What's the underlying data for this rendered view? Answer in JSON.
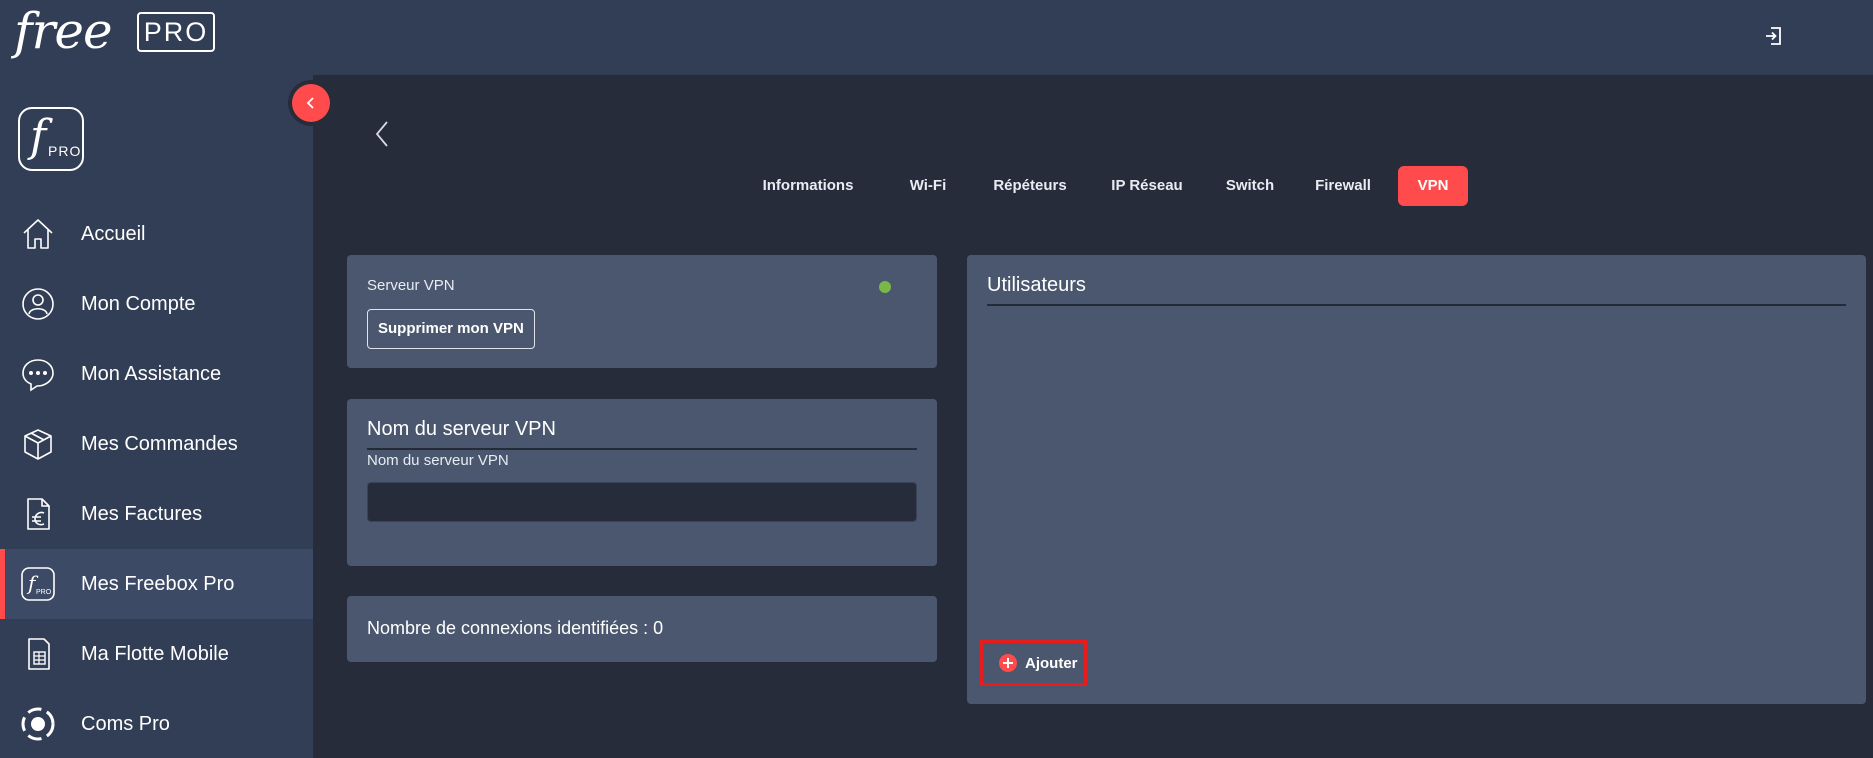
{
  "header": {
    "logo_free": "free",
    "logo_pro": "PRO",
    "logout_icon": "logout-icon"
  },
  "sidebar": {
    "collapse_icon": "chevron-left-icon",
    "logo_letter": "f",
    "logo_sub": "PRO",
    "items": [
      {
        "label": "Accueil",
        "icon": "home-icon",
        "active": false
      },
      {
        "label": "Mon Compte",
        "icon": "user-icon",
        "active": false
      },
      {
        "label": "Mon Assistance",
        "icon": "chat-icon",
        "active": false
      },
      {
        "label": "Mes Commandes",
        "icon": "box-icon",
        "active": false
      },
      {
        "label": "Mes Factures",
        "icon": "invoice-euro-icon",
        "active": false
      },
      {
        "label": "Mes Freebox Pro",
        "icon": "freebox-pro-icon",
        "active": true
      },
      {
        "label": "Ma Flotte Mobile",
        "icon": "sim-card-icon",
        "active": false
      },
      {
        "label": "Coms Pro",
        "icon": "coms-icon",
        "active": false
      }
    ]
  },
  "tabs": [
    {
      "label": "Informations",
      "active": false
    },
    {
      "label": "Wi-Fi",
      "active": false
    },
    {
      "label": "Répéteurs",
      "active": false
    },
    {
      "label": "IP Réseau",
      "active": false
    },
    {
      "label": "Switch",
      "active": false
    },
    {
      "label": "Firewall",
      "active": false
    },
    {
      "label": "VPN",
      "active": true
    }
  ],
  "vpn_server": {
    "label": "Serveur VPN",
    "status_color": "#7ab648",
    "delete_button": "Supprimer mon VPN"
  },
  "server_name": {
    "title": "Nom du serveur VPN",
    "field_label": "Nom du serveur VPN",
    "value": ""
  },
  "connections": {
    "text": "Nombre de connexions identifiées : 0"
  },
  "users": {
    "title": "Utilisateurs",
    "add_button": "Ajouter"
  },
  "colors": {
    "accent": "#ff4b4b",
    "sidebar_bg": "#323e55",
    "page_bg": "#262c3a",
    "card_bg": "#4a576e",
    "highlight_border": "#e81c1c"
  }
}
